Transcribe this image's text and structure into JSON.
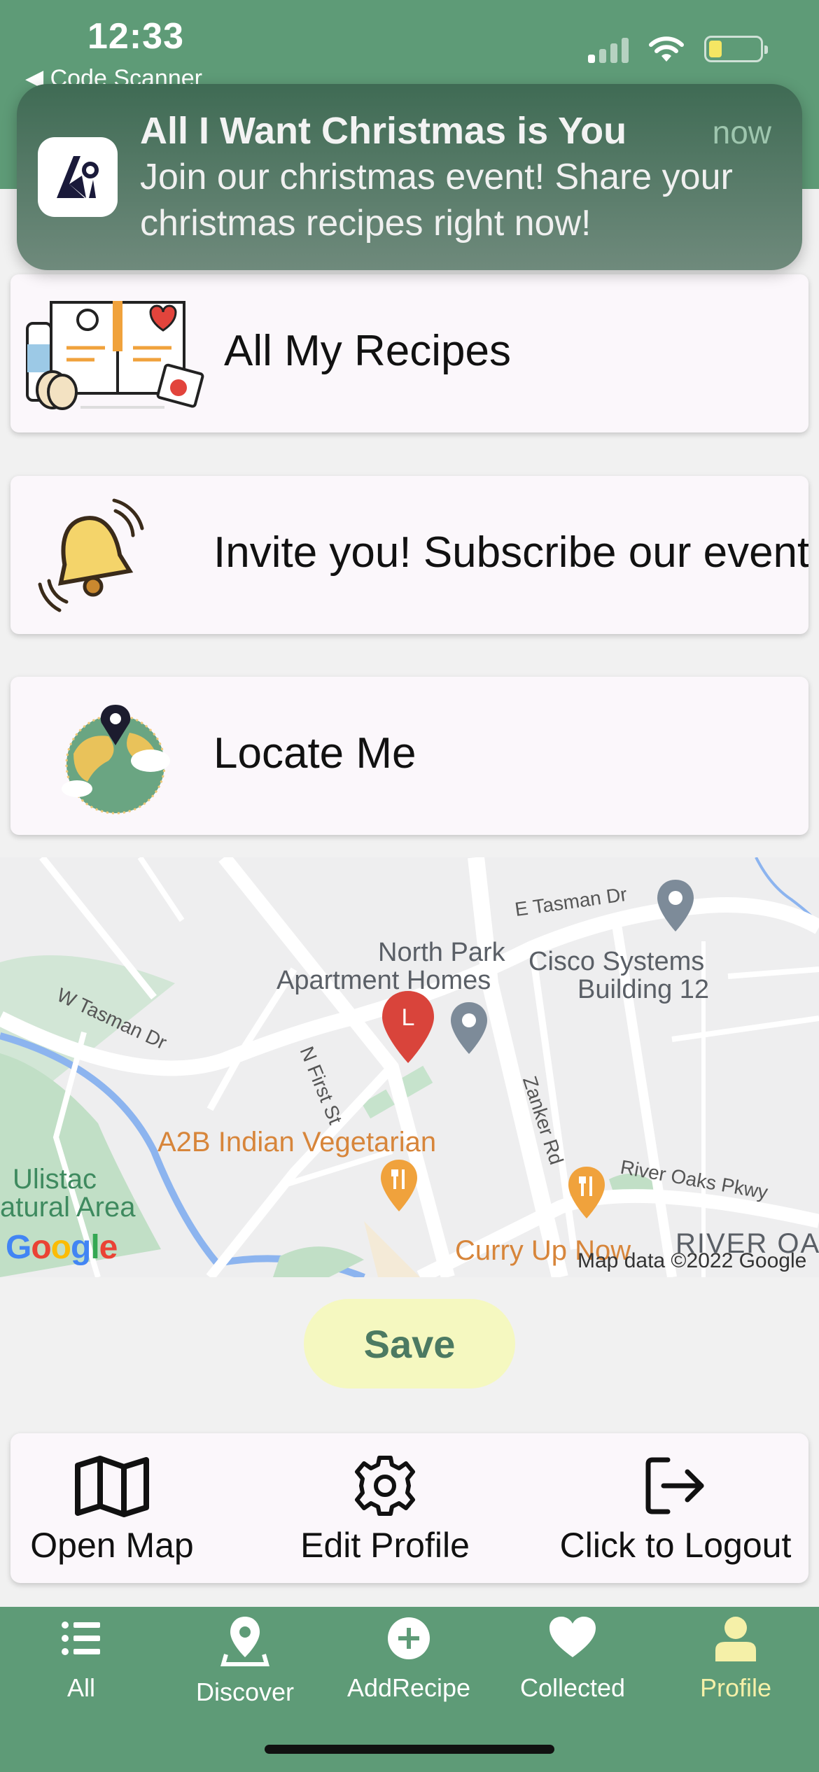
{
  "status_bar": {
    "time": "12:33",
    "back_app": "◀ Code Scanner"
  },
  "notification": {
    "title": "All I Want Christmas is You",
    "time": "now",
    "body": "Join our christmas event! Share your christmas recipes right now!"
  },
  "cards": {
    "recipes_label": "All My Recipes",
    "invite_label": "Invite you! Subscribe our event",
    "locate_label": "Locate Me"
  },
  "map": {
    "labels": {
      "north_park": "North Park",
      "apartment_homes": "Apartment Homes",
      "cisco": "Cisco Systems",
      "building": "Building 12",
      "a2b": "A2B Indian Vegetarian",
      "ulistac": "Ulistac",
      "natural_area": "atural Area",
      "curry": "Curry Up Now",
      "river_oaks_area": "RIVER OA"
    },
    "roads": {
      "e_tasman": "E Tasman Dr",
      "w_tasman": "W Tasman Dr",
      "n_first": "N First St",
      "zanker": "Zanker Rd",
      "river_oaks": "River Oaks Pkwy"
    },
    "marker_letter": "L",
    "google": "Google",
    "copyright": "Map data ©2022 Google"
  },
  "save_label": "Save",
  "actions": {
    "open_map": "Open Map",
    "edit_profile": "Edit Profile",
    "logout": "Click to Logout"
  },
  "tabs": [
    {
      "label": "All",
      "icon": "list-icon"
    },
    {
      "label": "Discover",
      "icon": "map-pin-icon"
    },
    {
      "label": "AddRecipe",
      "icon": "plus-circle-icon"
    },
    {
      "label": "Collected",
      "icon": "heart-icon"
    },
    {
      "label": "Profile",
      "icon": "user-icon"
    }
  ],
  "active_tab": "Profile",
  "colors": {
    "brand_green": "#5e9b77",
    "save_bg": "#f5f8c0",
    "active_tab": "#f5f0a8",
    "marker_red": "#d9443b"
  }
}
